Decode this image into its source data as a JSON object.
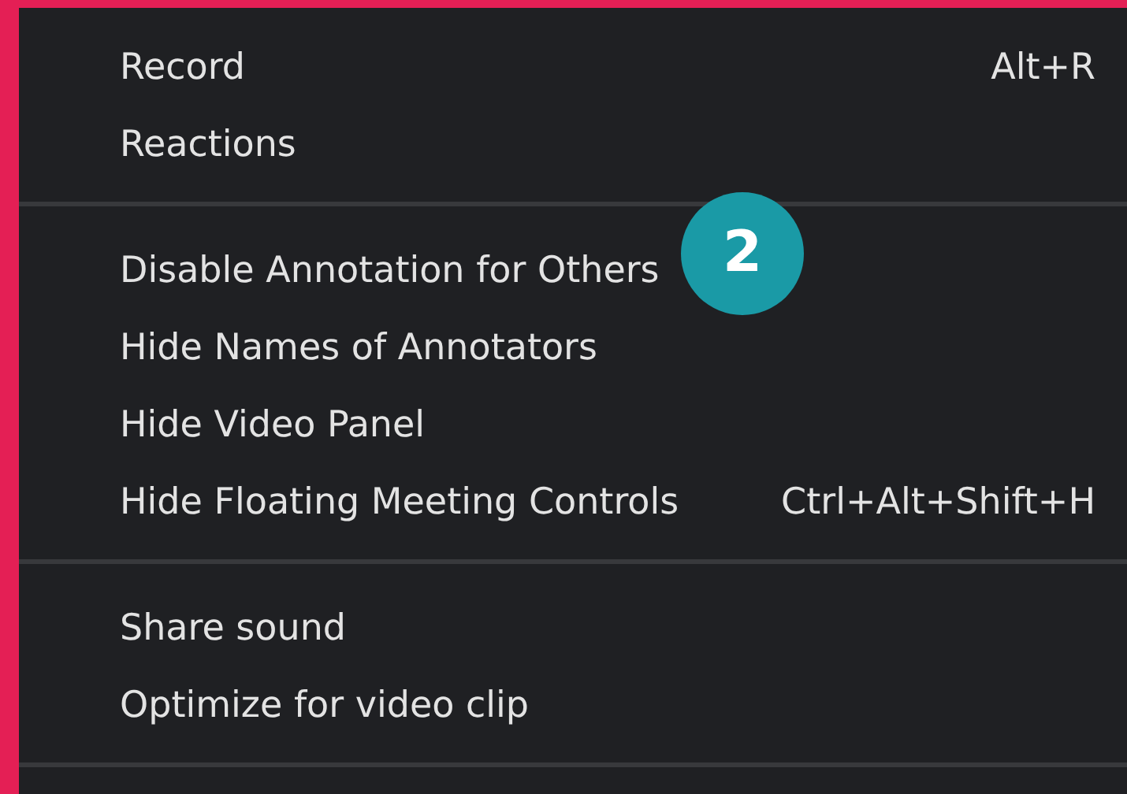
{
  "menu": {
    "sections": [
      {
        "items": [
          {
            "label": "Record",
            "shortcut": "Alt+R"
          },
          {
            "label": "Reactions"
          }
        ]
      },
      {
        "items": [
          {
            "label": "Disable Annotation for Others"
          },
          {
            "label": "Hide Names of Annotators"
          },
          {
            "label": "Hide Video Panel"
          },
          {
            "label": "Hide Floating Meeting Controls",
            "shortcut": "Ctrl+Alt+Shift+H"
          }
        ]
      },
      {
        "items": [
          {
            "label": "Share sound"
          },
          {
            "label": "Optimize for video clip"
          }
        ]
      }
    ]
  },
  "step_badge": {
    "text": "2"
  }
}
